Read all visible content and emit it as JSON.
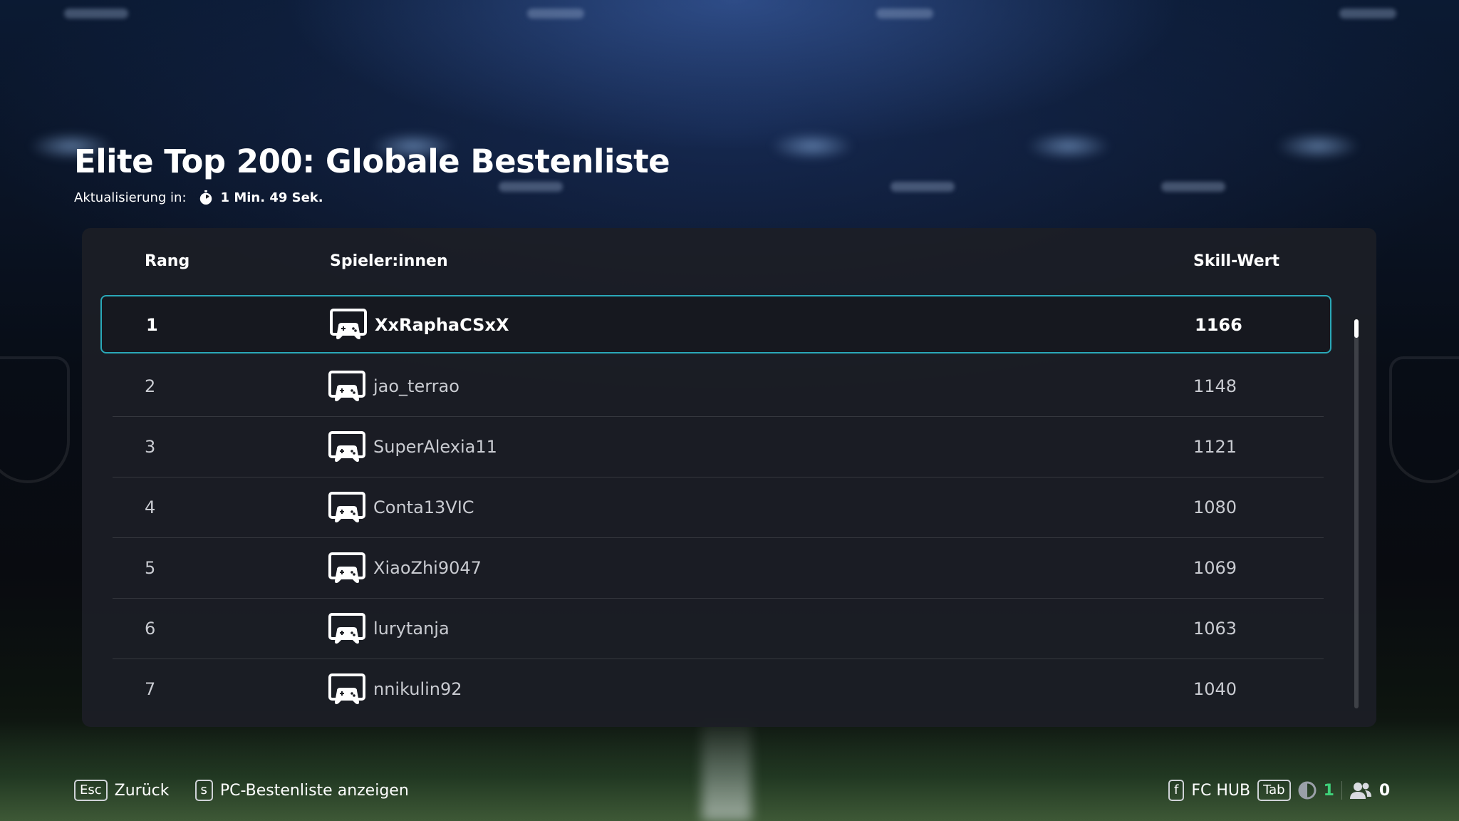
{
  "page": {
    "title": "Elite Top 200: Globale Bestenliste",
    "refresh_label": "Aktualisierung in:",
    "refresh_time": "1 Min. 49 Sek."
  },
  "table": {
    "headers": {
      "rank": "Rang",
      "player": "Spieler:innen",
      "skill": "Skill-Wert"
    },
    "rows": [
      {
        "rank": "1",
        "name": "XxRaphaCSxX",
        "skill": "1166",
        "selected": true
      },
      {
        "rank": "2",
        "name": "jao_terrao",
        "skill": "1148"
      },
      {
        "rank": "3",
        "name": "SuperAlexia11",
        "skill": "1121"
      },
      {
        "rank": "4",
        "name": "Conta13VIC",
        "skill": "1080"
      },
      {
        "rank": "5",
        "name": "XiaoZhi9047",
        "skill": "1069"
      },
      {
        "rank": "6",
        "name": "lurytanja",
        "skill": "1063"
      },
      {
        "rank": "7",
        "name": "nnikulin92",
        "skill": "1040"
      }
    ],
    "row_icon": "controller-screen-icon"
  },
  "footer": {
    "back_key": "Esc",
    "back_label": "Zurück",
    "pc_key": "s",
    "pc_label": "PC-Bestenliste anzeigen",
    "hub_key": "f",
    "hub_label": "FC HUB",
    "tab_key": "Tab",
    "notifications_count": "1",
    "friends_count": "0"
  },
  "colors": {
    "selection_border": "#2aa8b8",
    "panel_bg": "#1c1e26",
    "notification_green": "#3fd27a"
  }
}
